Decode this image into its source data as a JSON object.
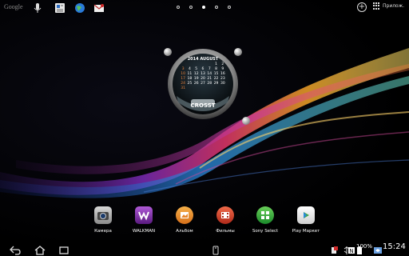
{
  "topbar": {
    "google_label": "Google",
    "apps_label": "Прилож.",
    "page_count": 5,
    "active_page": 3
  },
  "widget": {
    "calendar_title": "2014 AUGUST",
    "weekday_row": "SUN MON TUE WED THU FRI SAT",
    "dates": [
      "1",
      "2",
      "3",
      "4",
      "5",
      "6",
      "7",
      "8",
      "9",
      "10",
      "11",
      "12",
      "13",
      "14",
      "15",
      "16",
      "17",
      "18",
      "19",
      "20",
      "21",
      "22",
      "23",
      "24",
      "25",
      "26",
      "27",
      "28",
      "29",
      "30",
      "31"
    ],
    "day_strip": [
      "",
      "",
      "",
      "",
      "",
      "",
      ""
    ],
    "label": "CROSST"
  },
  "dock": {
    "apps": [
      {
        "label": "Камера",
        "icon": "camera-icon",
        "color": "#b0b0b0"
      },
      {
        "label": "WALKMAN",
        "icon": "walkman-icon",
        "color": "#8a3fb0"
      },
      {
        "label": "Альбом",
        "icon": "album-icon",
        "color": "#e8862a"
      },
      {
        "label": "Фильмы",
        "icon": "movies-icon",
        "color": "#d9432a"
      },
      {
        "label": "Sony Select",
        "icon": "sony-select-icon",
        "color": "#3aa43a"
      },
      {
        "label": "Play Маркет",
        "icon": "play-market-icon",
        "color": "#f2f2f2"
      }
    ]
  },
  "statusbar": {
    "battery": "100%",
    "time": "15:24"
  }
}
